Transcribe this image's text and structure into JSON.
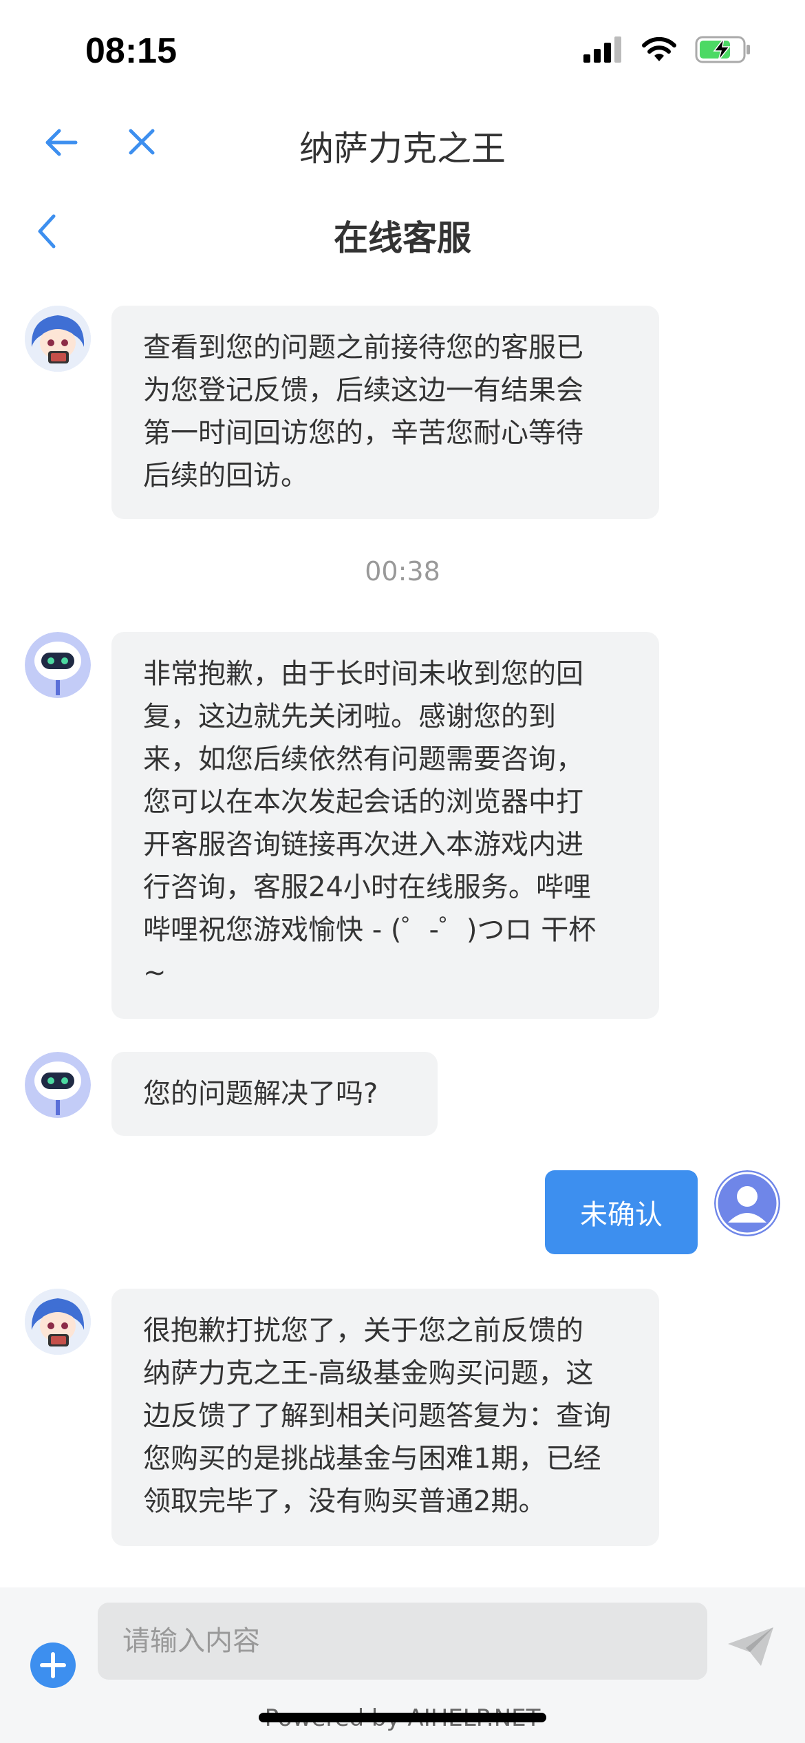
{
  "status_bar": {
    "time": "08:15"
  },
  "browser": {
    "title": "纳萨力克之王"
  },
  "header": {
    "title": "在线客服"
  },
  "messages": [
    {
      "sender": "agent-anime",
      "text": "查看到您的问题之前接待您的客服已\n为您登记反馈，后续这边一有结果会\n第一时间回访您的，辛苦您耐心等待\n后续的回访。"
    },
    {
      "type": "timestamp",
      "text": "00:38"
    },
    {
      "sender": "bot",
      "text": "非常抱歉，由于长时间未收到您的回\n复，这边就先关闭啦。感谢您的到\n来，如您后续依然有问题需要咨询，\n您可以在本次发起会话的浏览器中打\n开客服咨询链接再次进入本游戏内进\n行咨询，客服24小时在线服务。哔哩\n哔哩祝您游戏愉快 - (゜-゜)つロ 干杯\n~"
    },
    {
      "sender": "bot",
      "text": "您的问题解决了吗?"
    },
    {
      "sender": "user",
      "text": "未确认"
    },
    {
      "sender": "agent-anime",
      "text": "很抱歉打扰您了，关于您之前反馈的\n纳萨力克之王-高级基金购买问题，这\n边反馈了了解到相关问题答复为：查询\n您购买的是挑战基金与困难1期，已经\n领取完毕了，没有购买普通2期。"
    }
  ],
  "input": {
    "placeholder": "请输入内容"
  },
  "footer": {
    "powered_by": "Powered by AIHELP.NET"
  },
  "colors": {
    "accent": "#3d8fef",
    "bubble": "#f2f3f4",
    "bot_avatar": "#b9c3f5"
  }
}
